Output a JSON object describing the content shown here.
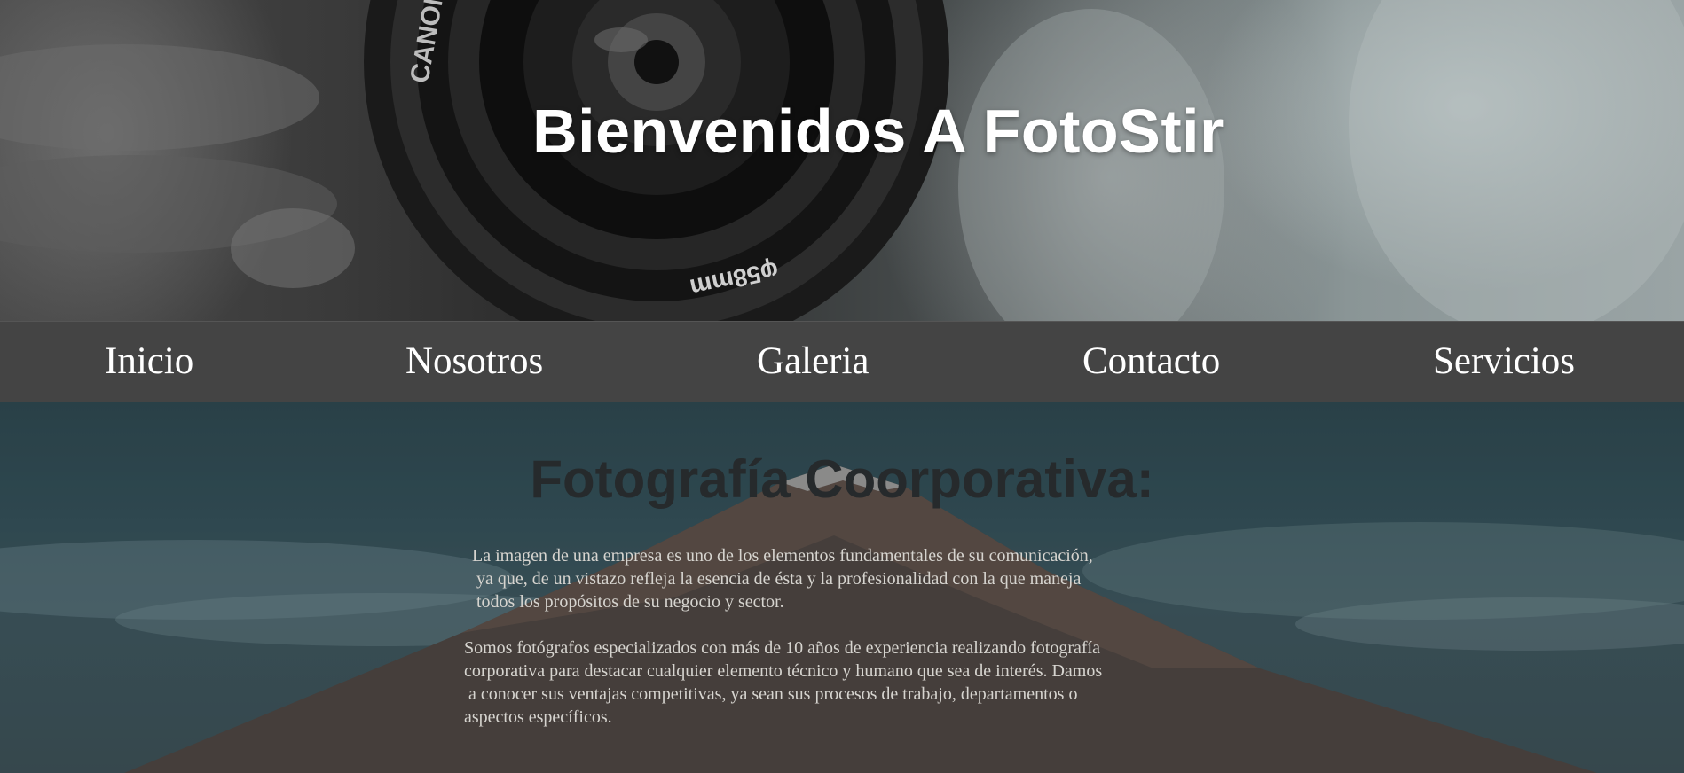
{
  "hero": {
    "title": "Bienvenidos A FotoStir",
    "lens_brand": "CANON",
    "lens_size": "φ58mm"
  },
  "nav": {
    "items": [
      {
        "label": "Inicio"
      },
      {
        "label": "Nosotros"
      },
      {
        "label": "Galeria"
      },
      {
        "label": "Contacto"
      },
      {
        "label": "Servicios"
      }
    ]
  },
  "main": {
    "title": "Fotografía Coorporativa:",
    "paragraph1": "La imagen de una empresa es uno de los elementos fundamentales de su comunicación,\n ya que, de un vistazo refleja la esencia de ésta y la profesionalidad con la que maneja\n todos los propósitos de su negocio y sector.",
    "paragraph2": "Somos fotógrafos especializados con más de 10 años de experiencia realizando fotografía\ncorporativa para destacar cualquier elemento técnico y humano que sea de interés. Damos\n a conocer sus ventajas competitivas, ya sean sus procesos de trabajo, departamentos o\naspectos específicos."
  },
  "colors": {
    "nav_background": "#444444",
    "nav_text": "#ffffff",
    "hero_title": "#ffffff",
    "section_title": "#262a2c",
    "paragraph_text": "#d6d4cf"
  }
}
